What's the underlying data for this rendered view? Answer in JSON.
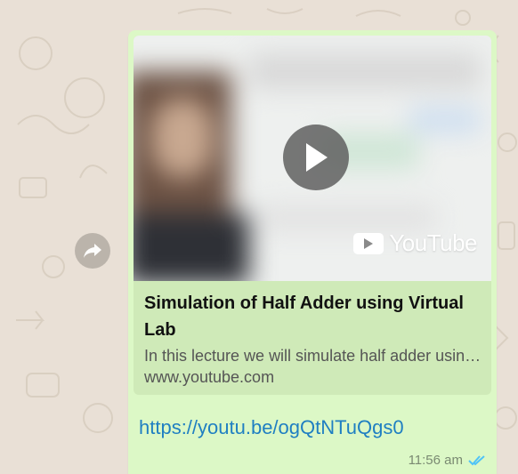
{
  "message": {
    "preview": {
      "title": "Simulation of Half Adder using Virtual Lab",
      "description": "In this lecture we will simulate half adder using virtual lab",
      "domain": "www.youtube.com",
      "brand": "YouTube"
    },
    "link": "https://youtu.be/ogQtNTuQgs0",
    "time": "11:56 am",
    "status": "read"
  },
  "icons": {
    "forward": "forward-arrow-icon",
    "play": "play-icon",
    "ticks": "double-check-icon"
  },
  "colors": {
    "bubble": "#dcf8c6",
    "card": "#cfeab8",
    "link": "#1f7fc2",
    "read_ticks": "#4fc3f7"
  }
}
